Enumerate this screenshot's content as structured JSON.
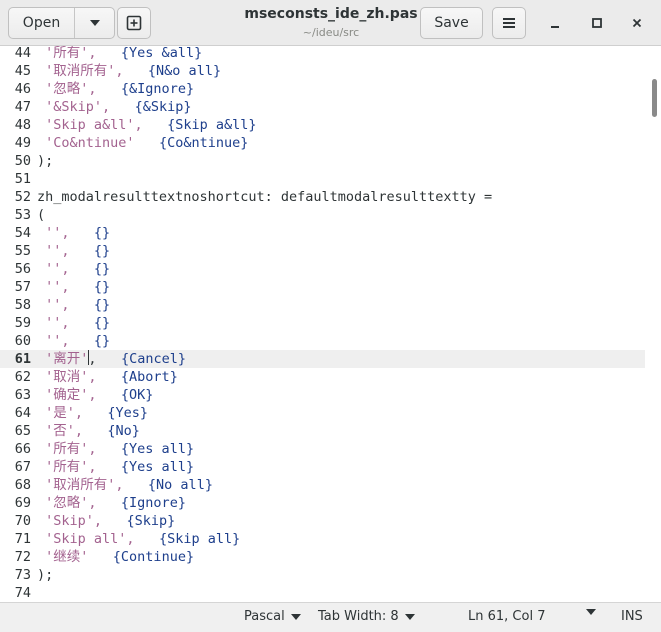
{
  "header": {
    "open_label": "Open",
    "title": "mseconsts_ide_zh.pas",
    "subtitle": "~/ideu/src",
    "save_label": "Save"
  },
  "editor": {
    "lines": [
      {
        "n": "44",
        "s": "'所有',",
        "g": "   ",
        "c": "{Yes &all}"
      },
      {
        "n": "45",
        "s": "'取消所有',",
        "g": "   ",
        "c": "{N&o all}"
      },
      {
        "n": "46",
        "s": "'忽略',",
        "g": "   ",
        "c": "{&Ignore}"
      },
      {
        "n": "47",
        "s": "'&Skip',",
        "g": "   ",
        "c": "{&Skip}"
      },
      {
        "n": "48",
        "s": "'Skip a&ll',",
        "g": "   ",
        "c": "{Skip a&ll}"
      },
      {
        "n": "49",
        "s": "'Co&ntinue'",
        "g": "   ",
        "c": "{Co&ntinue}"
      },
      {
        "n": "50",
        "code": ");"
      },
      {
        "n": "51",
        "code": ""
      },
      {
        "n": "52",
        "code": "zh_modalresulttextnoshortcut: defaultmodalresulttextty ="
      },
      {
        "n": "53",
        "code": "("
      },
      {
        "n": "54",
        "s": "'',",
        "g": "   ",
        "c": "{}"
      },
      {
        "n": "55",
        "s": "'',",
        "g": "   ",
        "c": "{}"
      },
      {
        "n": "56",
        "s": "'',",
        "g": "   ",
        "c": "{}"
      },
      {
        "n": "57",
        "s": "'',",
        "g": "   ",
        "c": "{}"
      },
      {
        "n": "58",
        "s": "'',",
        "g": "   ",
        "c": "{}"
      },
      {
        "n": "59",
        "s": "'',",
        "g": "   ",
        "c": "{}"
      },
      {
        "n": "60",
        "s": "'',",
        "g": "   ",
        "c": "{}"
      },
      {
        "n": "61",
        "s": "'离开'",
        "cur": true,
        "after": ",",
        "g": "   ",
        "c": "{Cancel}"
      },
      {
        "n": "62",
        "s": "'取消',",
        "g": "   ",
        "c": "{Abort}"
      },
      {
        "n": "63",
        "s": "'确定',",
        "g": "   ",
        "c": "{OK}"
      },
      {
        "n": "64",
        "s": "'是',",
        "g": "   ",
        "c": "{Yes}"
      },
      {
        "n": "65",
        "s": "'否',",
        "g": "   ",
        "c": "{No}"
      },
      {
        "n": "66",
        "s": "'所有',",
        "g": "   ",
        "c": "{Yes all}"
      },
      {
        "n": "67",
        "s": "'所有',",
        "g": "   ",
        "c": "{Yes all}"
      },
      {
        "n": "68",
        "s": "'取消所有',",
        "g": "   ",
        "c": "{No all}"
      },
      {
        "n": "69",
        "s": "'忽略',",
        "g": "   ",
        "c": "{Ignore}"
      },
      {
        "n": "70",
        "s": "'Skip',",
        "g": "   ",
        "c": "{Skip}"
      },
      {
        "n": "71",
        "s": "'Skip all',",
        "g": "   ",
        "c": "{Skip all}"
      },
      {
        "n": "72",
        "s": "'继续'",
        "g": "   ",
        "c": "{Continue}"
      },
      {
        "n": "73",
        "code": ");"
      },
      {
        "n": "74",
        "code": ""
      }
    ]
  },
  "statusbar": {
    "language": "Pascal",
    "tab_width": "Tab Width: 8",
    "position": "Ln 61, Col 7",
    "mode": "INS"
  },
  "icons": {
    "open_dropdown": "chevron-down-icon",
    "new_tab": "new-tab-icon",
    "menu": "hamburger-menu-icon",
    "minimize": "minimize-icon",
    "maximize": "maximize-icon",
    "close": "close-icon"
  },
  "colors": {
    "string": "#a3628f",
    "comment": "#1e3f8c",
    "current_line": "#efefef"
  }
}
